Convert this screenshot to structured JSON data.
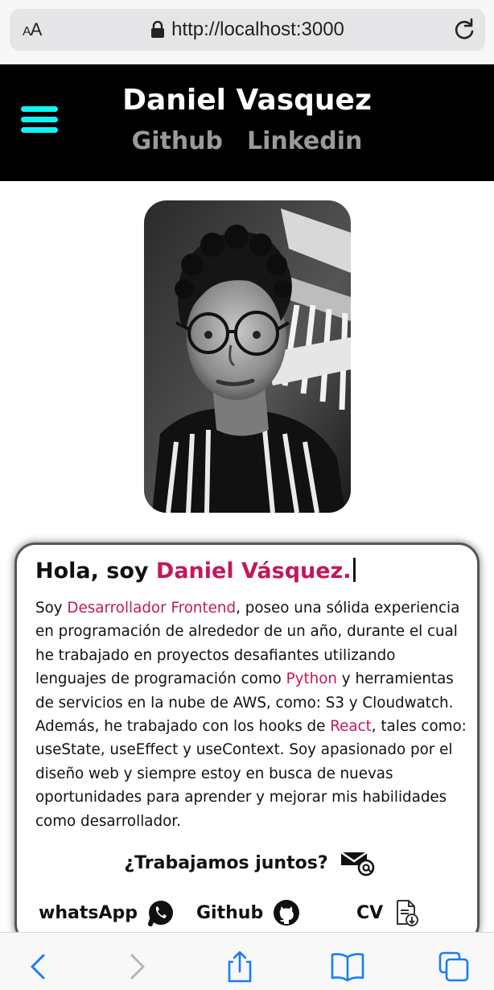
{
  "browser": {
    "text_size_label": "AA",
    "url": "http://localhost:3000"
  },
  "header": {
    "title": "Daniel Vasquez",
    "nav": [
      "Github",
      "Linkedin"
    ]
  },
  "about": {
    "greeting": "Hola, soy ",
    "name": "Daniel Vásquez.",
    "bio_segments": [
      {
        "text": "Soy ",
        "highlight": false
      },
      {
        "text": "Desarrollador Frontend",
        "highlight": true
      },
      {
        "text": ", poseo una sólida experiencia en programación de alrededor de un año, durante el cual he trabajado en proyectos desafiantes utilizando lenguajes de programación como ",
        "highlight": false
      },
      {
        "text": "Python",
        "highlight": true
      },
      {
        "text": " y herramientas de servicios en la nube de AWS, como: S3 y Cloudwatch. Además, he trabajado con los hooks de ",
        "highlight": false
      },
      {
        "text": "React",
        "highlight": true
      },
      {
        "text": ", tales como: useState, useEffect y useContext. Soy apasionado por el diseño web y siempre estoy en busca de nuevas oportunidades para aprender y mejorar mis habilidades como desarrollador.",
        "highlight": false
      }
    ],
    "cta": "¿Trabajamos juntos?",
    "social": [
      {
        "label": "whatsApp",
        "icon": "whatsapp-icon"
      },
      {
        "label": "Github",
        "icon": "github-icon"
      },
      {
        "label": "CV",
        "icon": "document-download-icon"
      }
    ]
  },
  "colors": {
    "accent": "#c2185b",
    "hamburger": "#0ff3f7",
    "header_bg": "#000000",
    "safari_blue": "#1a7cf5"
  }
}
